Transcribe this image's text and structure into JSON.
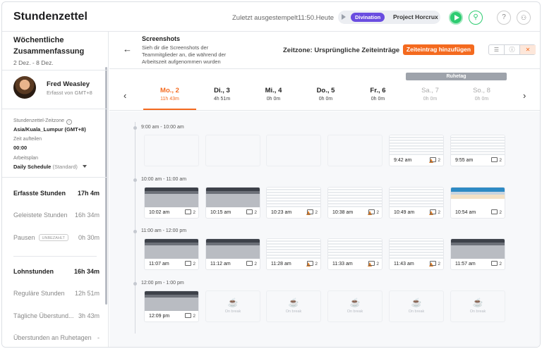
{
  "header": {
    "title": "Stundenzettel",
    "last_stamped": "Zuletzt ausgestempelt11:50.Heute",
    "project_tag": "Divination",
    "task_name": "Project Horcrux",
    "user_icon": "person-icon",
    "help_icon": "question-icon",
    "people_icon": "people-icon"
  },
  "sidebar": {
    "title": "Wöchentliche Zusammenfassung",
    "range": "2 Dez. - 8 Dez.",
    "user": {
      "name": "Fred Weasley",
      "sub": "Erfasst von GMT+8"
    },
    "timezone": {
      "label": "Stundenzettel-Zeitzone",
      "value": "Asia/Kuala_Lumpur (GMT+8)"
    },
    "split": {
      "label": "Zeit aufteilen",
      "value": "00:00"
    },
    "plan": {
      "label": "Arbeitsplan",
      "value": "Daily Schedule",
      "suffix": "(Standard)"
    },
    "stats": [
      {
        "label": "Erfasste Stunden",
        "value": "17h 4m"
      },
      {
        "label": "Geleistete Stunden",
        "value": "16h 34m"
      },
      {
        "label": "Pausen",
        "badge": "UNBEZAHLT",
        "value": "0h 30m"
      },
      {
        "label": "Lohnstunden",
        "value": "16h 34m"
      },
      {
        "label": "Reguläre Stunden",
        "value": "12h 51m"
      },
      {
        "label": "Tägliche Überstund...",
        "value": "3h 43m"
      },
      {
        "label": "Überstunden an Ruhetagen",
        "value": "-"
      }
    ]
  },
  "main": {
    "back_icon": "arrow-left-icon",
    "title": "Screenshots",
    "description": "Sieh dir die Screenshots der Teammitglieder an, die während der Arbeitszeit aufgenommen wurden",
    "timezone_select": "Zeitzone: Ursprüngliche Zeiteinträge",
    "add_button": "Zeiteintrag hinzufügen",
    "view_icons": [
      "list-icon",
      "info-icon",
      "close-icon"
    ],
    "rest_day_label": "Ruhetag",
    "days": [
      {
        "name": "Mo., 2",
        "hours": "11h 43m"
      },
      {
        "name": "Di., 3",
        "hours": "4h 51m"
      },
      {
        "name": "Mi., 4",
        "hours": "0h 0m"
      },
      {
        "name": "Do., 5",
        "hours": "0h 0m"
      },
      {
        "name": "Fr., 6",
        "hours": "0h 0m"
      },
      {
        "name": "Sa., 7",
        "hours": "0h 0m"
      },
      {
        "name": "So., 8",
        "hours": "0h 0m"
      }
    ],
    "hours": [
      {
        "label": "9:00 am - 10:00 am",
        "slots": [
          {
            "type": "empty"
          },
          {
            "type": "empty"
          },
          {
            "type": "empty"
          },
          {
            "type": "empty"
          },
          {
            "type": "shot",
            "time": "9:42 am",
            "count": "2",
            "style": "light",
            "flag": true
          },
          {
            "type": "shot",
            "time": "9:55 am",
            "count": "2",
            "style": "light",
            "flag": false
          }
        ]
      },
      {
        "label": "10:00 am - 11:00 am",
        "slots": [
          {
            "type": "shot",
            "time": "10:02 am",
            "count": "2",
            "style": "dark",
            "flag": false
          },
          {
            "type": "shot",
            "time": "10:15 am",
            "count": "2",
            "style": "dark",
            "flag": false
          },
          {
            "type": "shot",
            "time": "10:23 am",
            "count": "2",
            "style": "light",
            "flag": true
          },
          {
            "type": "shot",
            "time": "10:38 am",
            "count": "2",
            "style": "light",
            "flag": true
          },
          {
            "type": "shot",
            "time": "10:49 am",
            "count": "2",
            "style": "light",
            "flag": true
          },
          {
            "type": "shot",
            "time": "10:54 am",
            "count": "2",
            "style": "color",
            "flag": false
          }
        ]
      },
      {
        "label": "11:00 am - 12:00 pm",
        "slots": [
          {
            "type": "shot",
            "time": "11:07 am",
            "count": "2",
            "style": "dark",
            "flag": false
          },
          {
            "type": "shot",
            "time": "11:12 am",
            "count": "2",
            "style": "dark",
            "flag": false
          },
          {
            "type": "shot",
            "time": "11:28 am",
            "count": "2",
            "style": "light",
            "flag": true
          },
          {
            "type": "shot",
            "time": "11:33 am",
            "count": "2",
            "style": "light",
            "flag": true
          },
          {
            "type": "shot",
            "time": "11:43 am",
            "count": "2",
            "style": "light",
            "flag": true
          },
          {
            "type": "shot",
            "time": "11:57 am",
            "count": "2",
            "style": "dark",
            "flag": false
          }
        ]
      },
      {
        "label": "12:00 pm - 1:00 pm",
        "slots": [
          {
            "type": "shot",
            "time": "12:09 pm",
            "count": "2",
            "style": "dark",
            "flag": false
          },
          {
            "type": "break",
            "label": "On break"
          },
          {
            "type": "break",
            "label": "On break"
          },
          {
            "type": "break",
            "label": "On break"
          },
          {
            "type": "break",
            "label": "On break"
          },
          {
            "type": "break",
            "label": "On break"
          }
        ]
      }
    ]
  }
}
